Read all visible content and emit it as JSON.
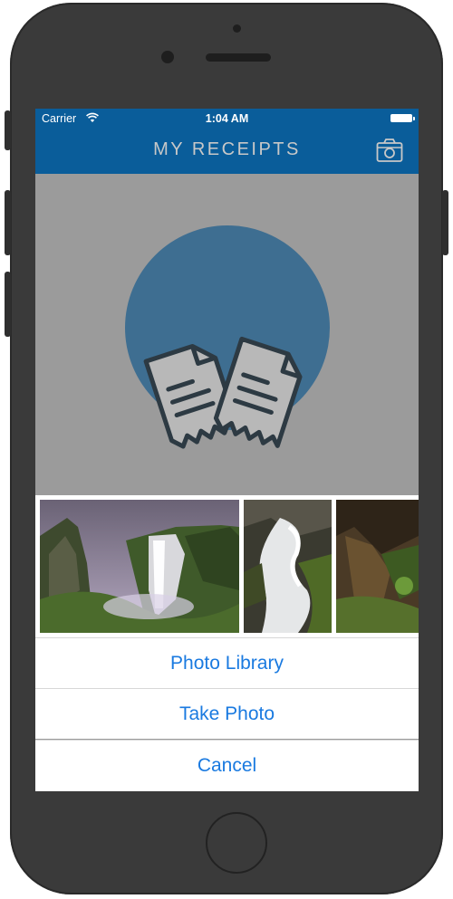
{
  "status_bar": {
    "carrier": "Carrier",
    "time": "1:04 AM"
  },
  "nav": {
    "title": "MY RECEIPTS",
    "camera_icon": "camera-icon"
  },
  "content": {
    "logo_icon": "receipts-icon"
  },
  "action_sheet": {
    "photos": [
      {
        "name": "waterfall-photo"
      },
      {
        "name": "stream-photo"
      },
      {
        "name": "cliff-photo"
      }
    ],
    "buttons": {
      "photo_library": "Photo Library",
      "take_photo": "Take Photo",
      "cancel": "Cancel"
    }
  },
  "colors": {
    "nav_blue": "#0a5d9a",
    "logo_circle": "#3e6e91",
    "dim_overlay": "#9b9b9b",
    "ios_blue": "#1a7ae0"
  }
}
